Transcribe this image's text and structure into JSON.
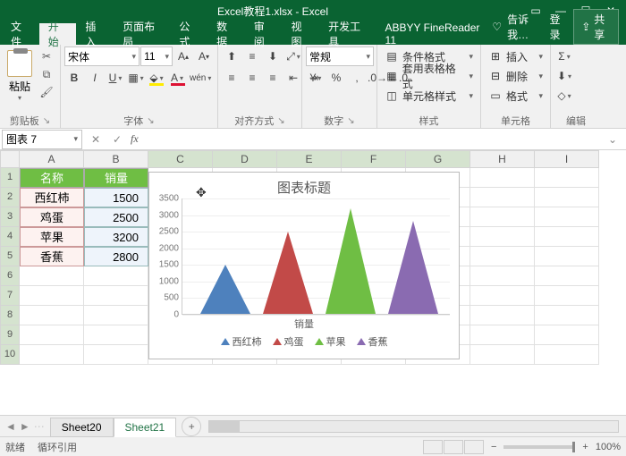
{
  "title": "Excel教程1.xlsx - Excel",
  "tabs": {
    "file": "文件",
    "home": "开始",
    "insert": "插入",
    "layout": "页面布局",
    "formulas": "公式",
    "data": "数据",
    "review": "审阅",
    "view": "视图",
    "dev": "开发工具",
    "abbyy": "ABBYY FineReader 11"
  },
  "tellme": "告诉我…",
  "login": "登录",
  "share": "共享",
  "clipboard": {
    "paste": "粘贴",
    "label": "剪贴板"
  },
  "font": {
    "name": "宋体",
    "size": "11",
    "label": "字体"
  },
  "align": {
    "label": "对齐方式",
    "wrap": "常规"
  },
  "number": {
    "format": "常规",
    "label": "数字"
  },
  "styles": {
    "cond": "条件格式",
    "table": "套用表格格式",
    "cell": "单元格样式",
    "label": "样式"
  },
  "cells": {
    "insert": "插入",
    "delete": "删除",
    "format": "格式",
    "label": "单元格"
  },
  "editing": {
    "label": "编辑"
  },
  "namebox": "图表 7",
  "columns": [
    "A",
    "B",
    "C",
    "D",
    "E",
    "F",
    "G",
    "H",
    "I"
  ],
  "rows": [
    "1",
    "2",
    "3",
    "4",
    "5",
    "6",
    "7",
    "8",
    "9",
    "10"
  ],
  "table": {
    "header": {
      "a": "名称",
      "b": "销量"
    },
    "data": [
      {
        "a": "西红柿",
        "b": "1500"
      },
      {
        "a": "鸡蛋",
        "b": "2500"
      },
      {
        "a": "苹果",
        "b": "3200"
      },
      {
        "a": "香蕉",
        "b": "2800"
      }
    ]
  },
  "chart_data": {
    "type": "bar",
    "title": "图表标题",
    "categories": [
      "西红柿",
      "鸡蛋",
      "苹果",
      "香蕉"
    ],
    "values": [
      1500,
      2500,
      3200,
      2800
    ],
    "colors": [
      "#4e81bd",
      "#c24a48",
      "#6fbe44",
      "#8a6bb1"
    ],
    "ylabel": "销量",
    "ylim": [
      0,
      3500
    ],
    "yticks": [
      0,
      500,
      1000,
      1500,
      2000,
      2500,
      3000,
      3500
    ]
  },
  "sheets": {
    "prev": "Sheet20",
    "active": "Sheet21"
  },
  "status": {
    "ready": "就绪",
    "circ": "循环引用",
    "zoom": "100%"
  }
}
